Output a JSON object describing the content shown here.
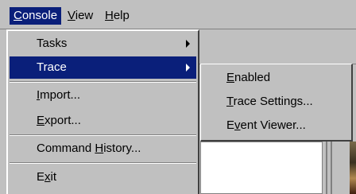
{
  "menubar": {
    "console": {
      "first": "C",
      "rest": "onsole"
    },
    "view": {
      "first": "V",
      "rest": "iew"
    },
    "help": {
      "first": "H",
      "rest": "elp"
    }
  },
  "menu": {
    "tasks": "Tasks",
    "trace": "Trace",
    "import": {
      "first": "I",
      "rest": "mport..."
    },
    "export": {
      "first": "E",
      "rest": "xport..."
    },
    "command_history": {
      "before": "Command ",
      "key": "H",
      "after": "istory..."
    },
    "exit": {
      "before": "E",
      "key": "x",
      "after": "it"
    }
  },
  "submenu": {
    "enabled": {
      "first": "E",
      "rest": "nabled"
    },
    "trace_settings": {
      "first": "T",
      "rest": "race Settings..."
    },
    "event_viewer": {
      "before": "E",
      "key": "v",
      "after": "ent Viewer..."
    }
  },
  "colors": {
    "highlight": "#0a1f7a",
    "face": "#c0c0c0"
  }
}
